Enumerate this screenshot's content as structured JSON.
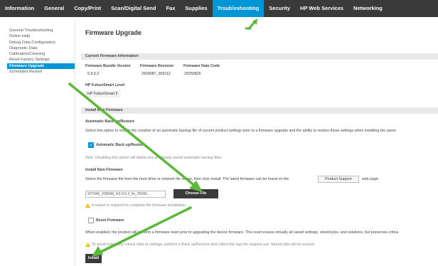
{
  "nav": {
    "tabs": [
      {
        "label": "Information"
      },
      {
        "label": "General"
      },
      {
        "label": "Copy/Print"
      },
      {
        "label": "Scan/Digital Send"
      },
      {
        "label": "Fax"
      },
      {
        "label": "Supplies"
      },
      {
        "label": "Troubleshooting"
      },
      {
        "label": "Security"
      },
      {
        "label": "HP Web Services"
      },
      {
        "label": "Networking"
      }
    ]
  },
  "sidebar": {
    "items": [
      {
        "label": "General Troubleshooting"
      },
      {
        "label": "Online Help"
      },
      {
        "label": "Debug Data Configuration"
      },
      {
        "label": "Diagnostic Data"
      },
      {
        "label": "Calibration/Cleaning"
      },
      {
        "label": "Reset Factory Settings"
      },
      {
        "label": "Firmware Upgrade"
      },
      {
        "label": "Scheduled Restart"
      }
    ]
  },
  "main": {
    "title": "Firmware Upgrade",
    "current_section": "Current Firmware Information",
    "bundle_label": "Firmware Bundle Version",
    "bundle_value": "5.9.0.2",
    "revision_label": "Firmware Revision",
    "revision_value": "2509087_000112",
    "date_label": "Firmware Date Code",
    "date_value": "20250826",
    "level_label": "HP FutureSmart Level",
    "level_value": "HP FutureSmart 5",
    "install_section": "Install New Firmware",
    "auto_backup_heading": "Automatic Back up/Restore",
    "auto_backup_desc": "Select this option to enable the creation of an automatic backup file of current product settings prior to a firmware upgrade and the ability to restore those settings when installing the same",
    "auto_backup_checkbox_label": "Automatic Back up/Restore",
    "auto_backup_note": "Note: Disabling this option will delete any previously saved automatic backup files.",
    "install_heading": "Install New Firmware",
    "install_desc": "Select the firmware file from the hard drive or network file server, then click Install. The latest firmware can be found on the",
    "support_button": "Product Support",
    "install_desc_end": "web page.",
    "file_value": "X57945_X58045_fs5.9.0.2_fw_25090...",
    "choose_file": "Choose File",
    "restart_note": "A restart is required to complete the firmware installation.",
    "reset_label": "Reset Firmware",
    "reset_desc": "When enabled, the product will perform a firmware reset prior to upgrading the device firmware. This reset erases virtually all saved settings, stored jobs, and solutions, but preserves critica",
    "reset_warn": "To avoid losing any critical data or settings, perform a Back up/Restore and collect the logs for support use. Stored jobs will be erased.",
    "install_button": "Install"
  },
  "colors": {
    "nav_bg": "#3a3a3a",
    "accent": "#0096d6",
    "arrow": "#5cb83a",
    "warning": "#f5b400"
  }
}
